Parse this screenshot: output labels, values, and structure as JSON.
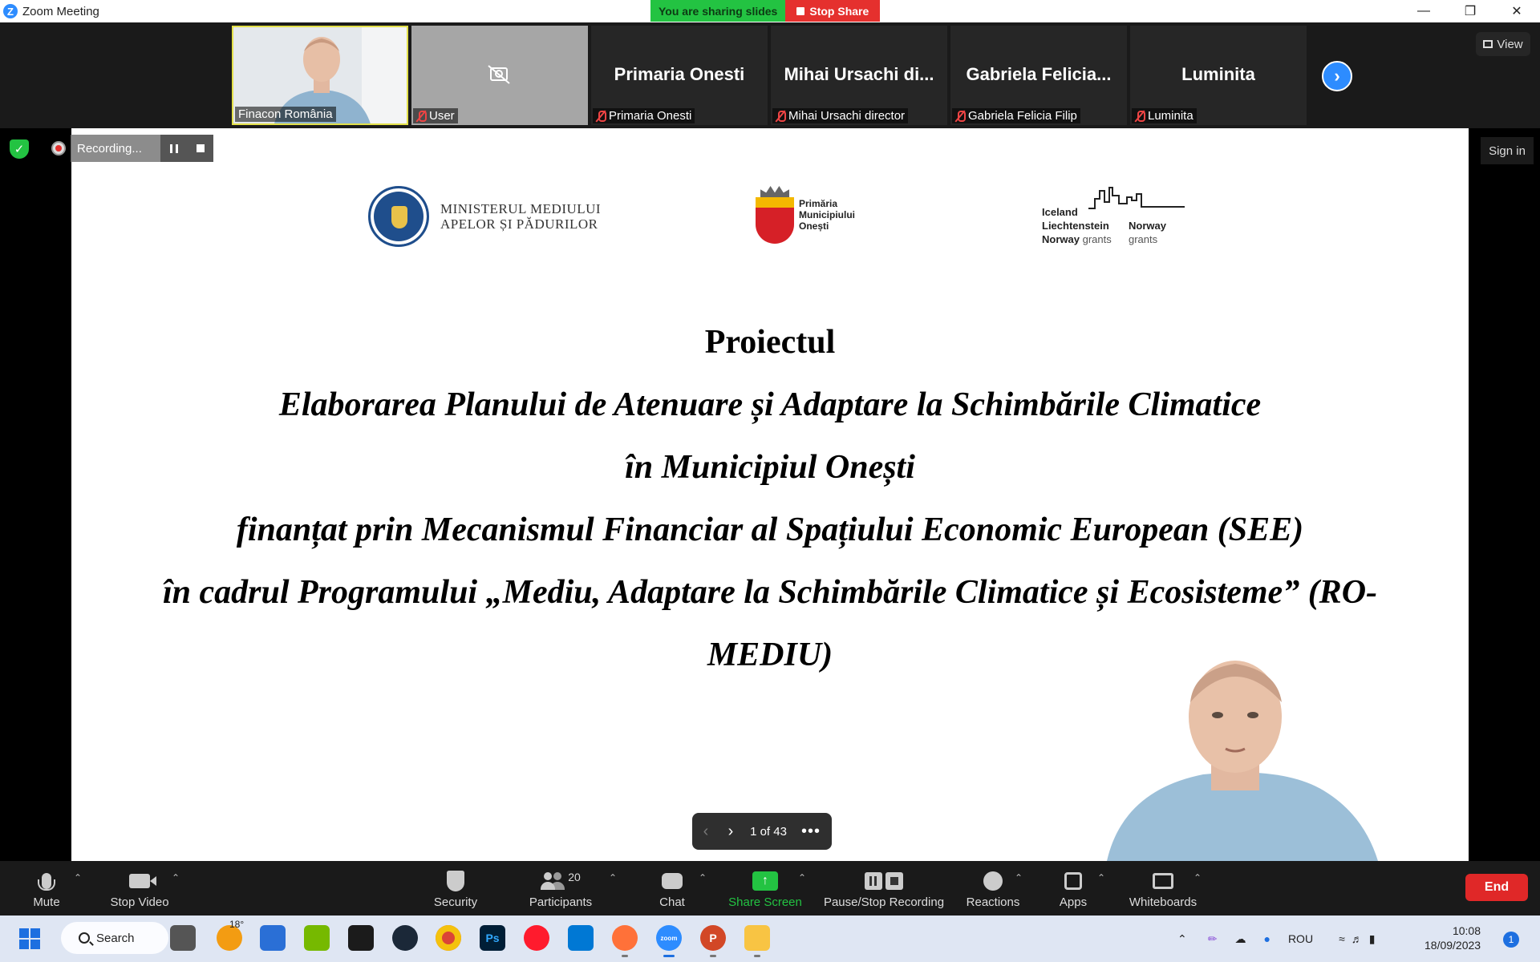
{
  "window": {
    "title": "Zoom Meeting",
    "app_icon": "zoom-logo-icon"
  },
  "share_banner": {
    "status": "You are sharing slides",
    "stop_label": "Stop Share"
  },
  "participants": [
    {
      "name": "Finacon România",
      "video": true,
      "active_speaker": true
    },
    {
      "name": "User",
      "video": false,
      "camera_off": true,
      "muted": true
    },
    {
      "display": "Primaria Onesti",
      "name": "Primaria Onesti",
      "muted": true
    },
    {
      "display": "Mihai  Ursachi  di...",
      "name": "Mihai Ursachi director",
      "muted": true
    },
    {
      "display": "Gabriela  Felicia...",
      "name": "Gabriela Felicia Filip",
      "muted": true
    },
    {
      "display": "Luminita",
      "name": "Luminita",
      "muted": true
    }
  ],
  "strip": {
    "view_label": "View",
    "next_icon": "chevron-right-icon"
  },
  "recording": {
    "label": "Recording..."
  },
  "sign_in_label": "Sign in",
  "slide": {
    "logos": {
      "ministry": {
        "line1": "MINISTERUL MEDIULUI",
        "line2": "APELOR ȘI PĂDURILOR",
        "seal_text": "GUVERNUL ROMÂNIEI"
      },
      "primaria": {
        "line1": "Primăria",
        "line2": "Municipiului",
        "line3": "Onești"
      },
      "eea": {
        "iceland": "Iceland",
        "liechtenstein": "Liechtenstein",
        "norway_right": "Norway",
        "norway": "Norway",
        "grants": "grants"
      }
    },
    "heading": "Proiectul",
    "lines": [
      "Elaborarea Planului de Atenuare și Adaptare la Schimbările Climatice",
      "în Municipiul Onești",
      "finanțat prin Mecanismul Financiar al Spațiului Economic European (SEE)",
      "în cadrul Programului „Mediu, Adaptare la Schimbările Climatice și Ecosisteme” (RO-",
      "MEDIU)"
    ]
  },
  "pager": {
    "current": 1,
    "total": 43,
    "label": "1 of 43"
  },
  "toolbar": {
    "mute": "Mute",
    "stop_video": "Stop Video",
    "security": "Security",
    "participants": "Participants",
    "participants_count": "20",
    "chat": "Chat",
    "share_screen": "Share Screen",
    "pause_stop_recording": "Pause/Stop Recording",
    "reactions": "Reactions",
    "apps": "Apps",
    "whiteboards": "Whiteboards",
    "end": "End"
  },
  "taskbar": {
    "search_label": "Search",
    "weather_temp": "18°",
    "language": "ROU",
    "time": "10:08",
    "date": "18/09/2023",
    "notification_count": "1",
    "apps": [
      "task-view-icon",
      "weather-icon",
      "store-icon",
      "nvidia-icon",
      "nvidia-app-icon",
      "steam-icon",
      "chrome-icon",
      "photoshop-icon",
      "opera-icon",
      "vscode-icon",
      "firefox-icon",
      "zoom-icon",
      "powerpoint-icon",
      "file-explorer-icon"
    ]
  },
  "colors": {
    "zoom_blue": "#2d8cff",
    "share_green": "#23c342",
    "stop_red": "#e5302e",
    "end_red": "#e02828"
  }
}
